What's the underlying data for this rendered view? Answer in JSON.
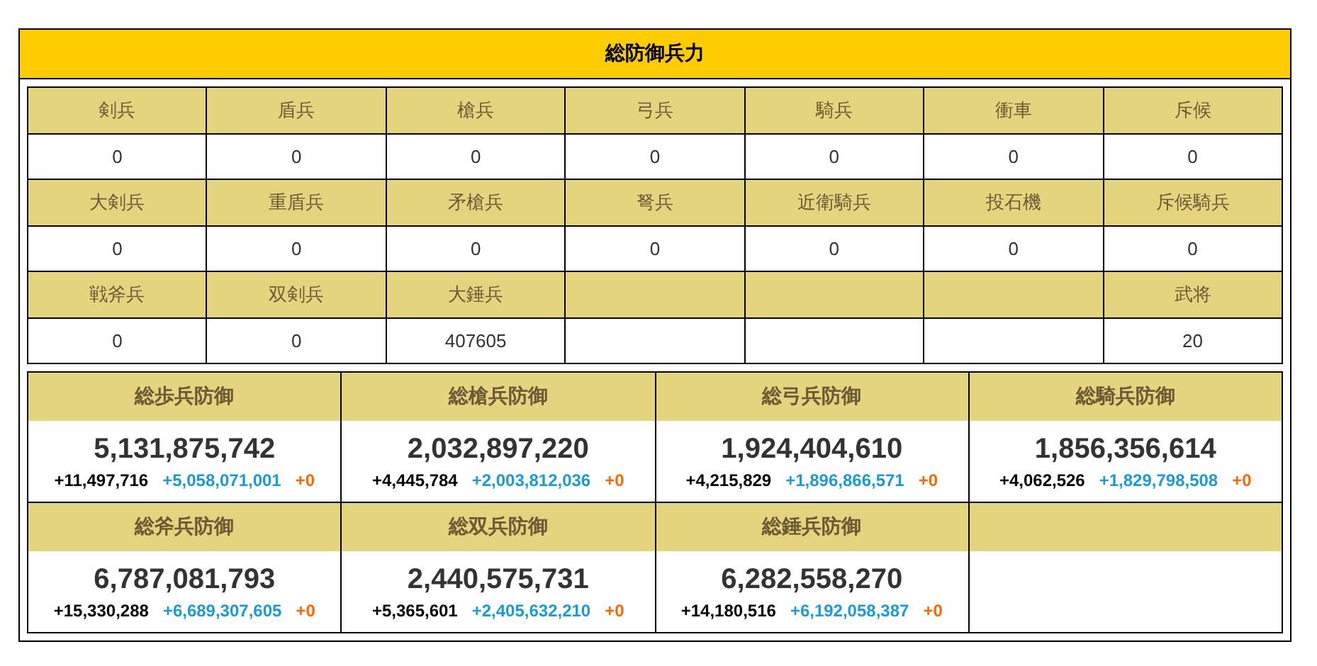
{
  "title": "総防御兵力",
  "unit_rows": [
    {
      "cells": [
        {
          "label": "剣兵",
          "value": "0"
        },
        {
          "label": "盾兵",
          "value": "0"
        },
        {
          "label": "槍兵",
          "value": "0"
        },
        {
          "label": "弓兵",
          "value": "0"
        },
        {
          "label": "騎兵",
          "value": "0"
        },
        {
          "label": "衝車",
          "value": "0"
        },
        {
          "label": "斥候",
          "value": "0"
        }
      ]
    },
    {
      "cells": [
        {
          "label": "大剣兵",
          "value": "0"
        },
        {
          "label": "重盾兵",
          "value": "0"
        },
        {
          "label": "矛槍兵",
          "value": "0"
        },
        {
          "label": "弩兵",
          "value": "0"
        },
        {
          "label": "近衛騎兵",
          "value": "0"
        },
        {
          "label": "投石機",
          "value": "0"
        },
        {
          "label": "斥候騎兵",
          "value": "0"
        }
      ]
    },
    {
      "cells": [
        {
          "label": "戦斧兵",
          "value": "0"
        },
        {
          "label": "双剣兵",
          "value": "0"
        },
        {
          "label": "大錘兵",
          "value": "407605"
        },
        {},
        {},
        {},
        {
          "label": "武将",
          "value": "20"
        }
      ]
    }
  ],
  "defense_cards": [
    {
      "title": "総歩兵防御",
      "total": "5,131,875,742",
      "parts": [
        {
          "kind": "base",
          "text": "+11,497,716"
        },
        {
          "kind": "bonus",
          "text": "+5,058,071,001"
        },
        {
          "kind": "extra",
          "text": "+0"
        }
      ]
    },
    {
      "title": "総槍兵防御",
      "total": "2,032,897,220",
      "parts": [
        {
          "kind": "base",
          "text": "+4,445,784"
        },
        {
          "kind": "bonus",
          "text": "+2,003,812,036"
        },
        {
          "kind": "extra",
          "text": "+0"
        }
      ]
    },
    {
      "title": "総弓兵防御",
      "total": "1,924,404,610",
      "parts": [
        {
          "kind": "base",
          "text": "+4,215,829"
        },
        {
          "kind": "bonus",
          "text": "+1,896,866,571"
        },
        {
          "kind": "extra",
          "text": "+0"
        }
      ]
    },
    {
      "title": "総騎兵防御",
      "total": "1,856,356,614",
      "parts": [
        {
          "kind": "base",
          "text": "+4,062,526"
        },
        {
          "kind": "bonus",
          "text": "+1,829,798,508"
        },
        {
          "kind": "extra",
          "text": "+0"
        }
      ]
    },
    {
      "title": "総斧兵防御",
      "total": "6,787,081,793",
      "parts": [
        {
          "kind": "base",
          "text": "+15,330,288"
        },
        {
          "kind": "bonus",
          "text": "+6,689,307,605"
        },
        {
          "kind": "extra",
          "text": "+0"
        }
      ]
    },
    {
      "title": "総双兵防御",
      "total": "2,440,575,731",
      "parts": [
        {
          "kind": "base",
          "text": "+5,365,601"
        },
        {
          "kind": "bonus",
          "text": "+2,405,632,210"
        },
        {
          "kind": "extra",
          "text": "+0"
        }
      ]
    },
    {
      "title": "総錘兵防御",
      "total": "6,282,558,270",
      "parts": [
        {
          "kind": "base",
          "text": "+14,180,516"
        },
        {
          "kind": "bonus",
          "text": "+6,192,058,387"
        },
        {
          "kind": "extra",
          "text": "+0"
        }
      ]
    }
  ]
}
